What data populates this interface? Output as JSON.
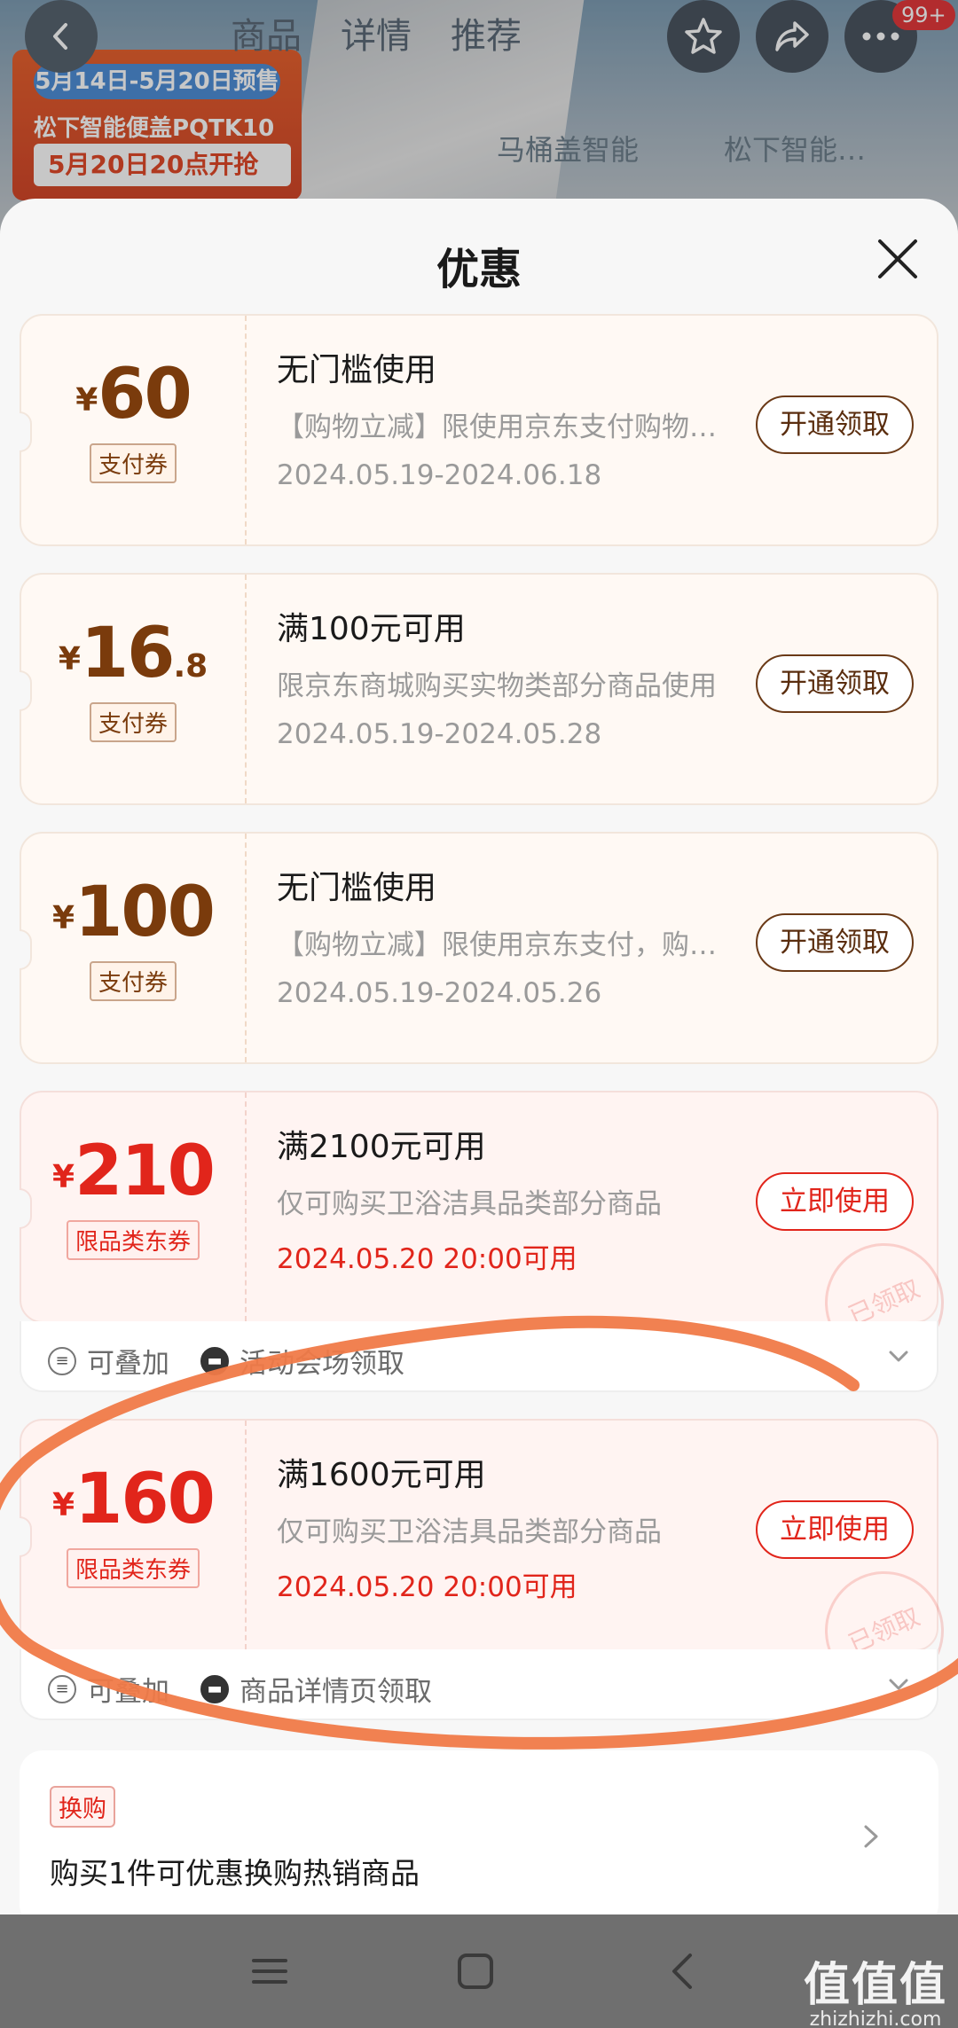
{
  "background": {
    "tabs": [
      "商品",
      "详情",
      "推荐"
    ],
    "banner_line1": "5月14日-5月20日预售",
    "banner_line2": "松下智能便盖PQTK10",
    "banner_line3": "5月20日20点开抢",
    "tags": [
      "马桶盖智能",
      "松下智能…"
    ],
    "badge": "99+"
  },
  "sheet": {
    "title": "优惠"
  },
  "coupons": [
    {
      "currency": "¥",
      "amount": "60",
      "decimal": "",
      "type": "支付券",
      "title": "无门槛使用",
      "desc": "【购物立减】限使用京东支付购物时使用",
      "date": "2024.05.19-2024.06.18",
      "button": "开通领取",
      "style": "pay"
    },
    {
      "currency": "¥",
      "amount": "16",
      "decimal": ".8",
      "type": "支付券",
      "title": "满100元可用",
      "desc": "限京东商城购买实物类部分商品使用",
      "date": "2024.05.19-2024.05.28",
      "button": "开通领取",
      "style": "pay"
    },
    {
      "currency": "¥",
      "amount": "100",
      "decimal": "",
      "type": "支付券",
      "title": "无门槛使用",
      "desc": "【购物立减】限使用京东支付，购物时使用",
      "date": "2024.05.19-2024.05.26",
      "button": "开通领取",
      "style": "pay"
    },
    {
      "currency": "¥",
      "amount": "210",
      "decimal": "",
      "type": "限品类东券",
      "title": "满2100元可用",
      "desc": "仅可购买卫浴洁具品类部分商品",
      "date": "2024.05.20 20:00可用",
      "button": "立即使用",
      "style": "dong",
      "stamp": "已领取",
      "foot_left": "可叠加",
      "foot_right": "活动会场领取"
    },
    {
      "currency": "¥",
      "amount": "160",
      "decimal": "",
      "type": "限品类东券",
      "title": "满1600元可用",
      "desc": "仅可购买卫浴洁具品类部分商品",
      "date": "2024.05.20 20:00可用",
      "button": "立即使用",
      "style": "dong",
      "stamp": "已领取",
      "foot_left": "可叠加",
      "foot_right": "商品详情页领取"
    }
  ],
  "swap": {
    "tag": "换购",
    "text": "购买1件可优惠换购热销商品"
  },
  "watermark": {
    "main": "值值值",
    "sub": "zhizhizhi.com"
  },
  "colors": {
    "accent_red": "#e1251b",
    "pay_brown": "#7a3b0c",
    "annotation_stroke": "#f07a48"
  }
}
